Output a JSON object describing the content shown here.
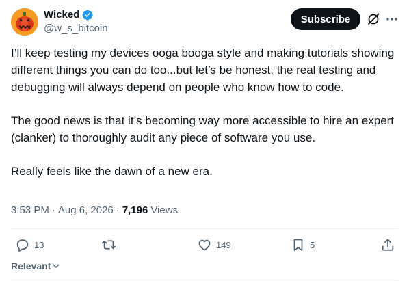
{
  "author": {
    "display_name": "Wicked",
    "handle": "@w_s_bitcoin",
    "avatar": "pumpkin-avatar",
    "verified_color": "#1d9bf0"
  },
  "header": {
    "subscribe_label": "Subscribe",
    "grok_icon": "slashed-circle-icon",
    "more_icon": "more-dots-icon"
  },
  "post": {
    "paragraphs": [
      "I’ll keep testing my devices ooga booga style and making tutorials showing different things you can do too...but let’s be honest, the real testing and debugging will always depend on people who know how to code.",
      "The good news is that it’s becoming way more accessible to hire an expert (clanker) to thoroughly audit any piece of software you use.",
      "Really feels like the dawn of a new era."
    ],
    "time": "3:53 PM",
    "date": "Aug 6, 2026",
    "views_count": "7,196",
    "views_label": "Views",
    "separator": "·"
  },
  "actions": {
    "replies": "13",
    "likes": "149",
    "bookmarks": "5"
  },
  "sort": {
    "label": "Relevant"
  },
  "colors": {
    "text": "#0f1419",
    "muted": "#536471",
    "accent": "#1d9bf0",
    "avatar_bg": "#f59a23"
  }
}
